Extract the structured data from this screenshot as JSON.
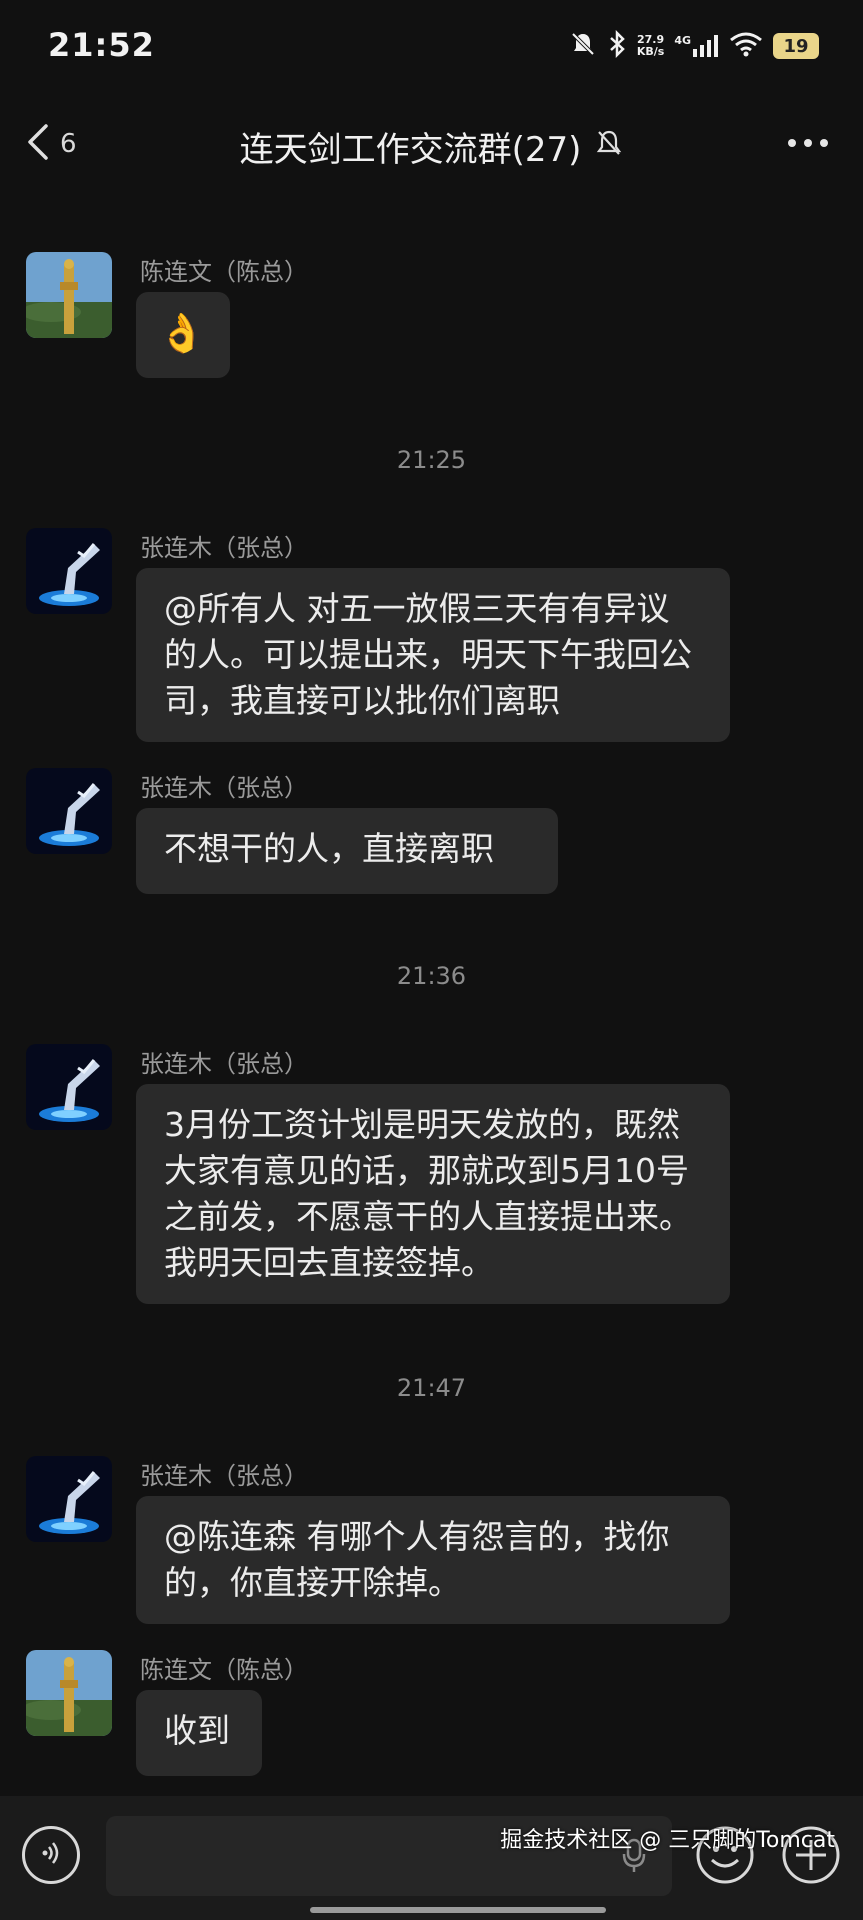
{
  "status": {
    "time": "21:52",
    "speed_value": "27.9",
    "speed_unit": "KB/s",
    "network": "4G",
    "battery": "19"
  },
  "header": {
    "back_count": "6",
    "title": "连天剑工作交流群(27)"
  },
  "messages": [
    {
      "sender": "陈连文（陈总）",
      "text": "👌"
    },
    {
      "timestamp": "21:25"
    },
    {
      "sender": "张连木（张总）",
      "text": "@所有人  对五一放假三天有有异议的人。可以提出来，明天下午我回公司，我直接可以批你们离职"
    },
    {
      "sender": "张连木（张总）",
      "text": "不想干的人，直接离职"
    },
    {
      "timestamp": "21:36"
    },
    {
      "sender": "张连木（张总）",
      "text": "3月份工资计划是明天发放的，既然大家有意见的话，那就改到5月10号之前发，不愿意干的人直接提出来。我明天回去直接签掉。"
    },
    {
      "timestamp": "21:47"
    },
    {
      "sender": "张连木（张总）",
      "text": "@陈连森  有哪个人有怨言的，找你的，你直接开除掉。"
    },
    {
      "sender": "陈连文（陈总）",
      "text": "收到"
    }
  ],
  "watermark": "掘金技术社区 @ 三只脚的Tomcat",
  "colors": {
    "background": "#111111",
    "bubble": "#2a2a2a",
    "battery": "#e9d58a"
  }
}
